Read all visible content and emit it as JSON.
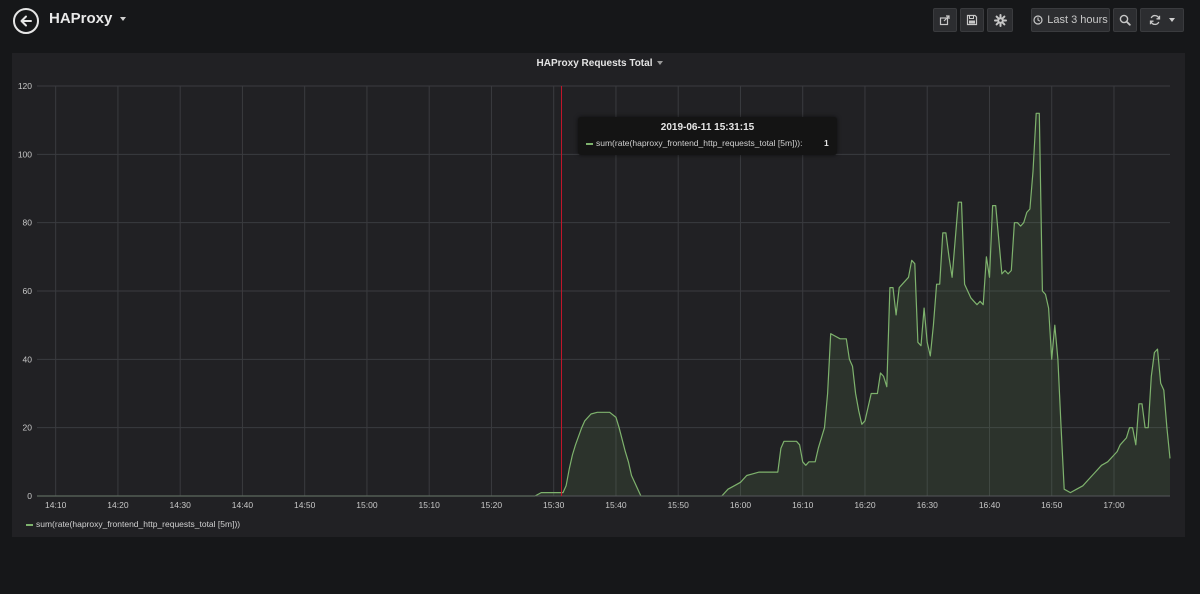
{
  "dashboard": {
    "title": "HAProxy",
    "time_range_label": "Last 3 hours"
  },
  "icons": {
    "back": "arrow-left-icon",
    "share": "share-icon",
    "save": "save-icon",
    "settings": "gear-icon",
    "clock": "clock-icon",
    "zoom": "zoom-out-icon",
    "refresh": "refresh-icon",
    "caret": "chevron-down-icon"
  },
  "panel": {
    "title": "HAProxy Requests Total"
  },
  "tooltip": {
    "time": "2019-06-11 15:31:15",
    "series": "sum(rate(haproxy_frontend_http_requests_total [5m])):",
    "value": "1"
  },
  "legend": {
    "label": "sum(rate(haproxy_frontend_http_requests_total [5m]))"
  },
  "colors": {
    "series": "#7eb26d",
    "crosshair": "#c4162a",
    "grid": "#3a3b3f"
  },
  "chart_data": {
    "type": "area",
    "ylim": [
      0,
      120
    ],
    "yticks": [
      0,
      20,
      40,
      60,
      80,
      100,
      120
    ],
    "xlim": [
      847,
      1029
    ],
    "xtick_values": [
      850,
      860,
      870,
      880,
      890,
      900,
      910,
      920,
      930,
      940,
      950,
      960,
      970,
      980,
      990,
      1000,
      1010,
      1020
    ],
    "xtick_labels": [
      "14:10",
      "14:20",
      "14:30",
      "14:40",
      "14:50",
      "15:00",
      "15:10",
      "15:20",
      "15:30",
      "15:40",
      "15:50",
      "16:00",
      "16:10",
      "16:20",
      "16:30",
      "16:40",
      "16:50",
      "17:00"
    ],
    "crosshair_x": 931.25,
    "grid": true,
    "legend": "bottom-left",
    "series": [
      {
        "name": "sum(rate(haproxy_frontend_http_requests_total [5m]))",
        "points": [
          [
            847,
            0
          ],
          [
            927,
            0
          ],
          [
            928,
            1
          ],
          [
            931.5,
            1
          ],
          [
            932,
            3
          ],
          [
            932.5,
            8
          ],
          [
            933,
            12
          ],
          [
            933.5,
            15
          ],
          [
            934.5,
            20
          ],
          [
            935,
            22
          ],
          [
            936,
            24
          ],
          [
            937,
            24.5
          ],
          [
            939,
            24.5
          ],
          [
            940,
            23
          ],
          [
            940.5,
            20
          ],
          [
            941.5,
            13
          ],
          [
            942,
            10
          ],
          [
            942.5,
            6
          ],
          [
            943,
            4
          ],
          [
            944,
            0
          ],
          [
            945,
            0
          ],
          [
            956,
            0
          ],
          [
            957,
            0
          ],
          [
            958,
            2
          ],
          [
            959,
            3
          ],
          [
            960,
            4
          ],
          [
            961,
            6
          ],
          [
            962,
            6.5
          ],
          [
            963,
            7
          ],
          [
            965,
            7
          ],
          [
            966,
            7
          ],
          [
            966.5,
            14
          ],
          [
            967,
            16
          ],
          [
            969,
            16
          ],
          [
            969.5,
            15
          ],
          [
            970,
            10
          ],
          [
            970.5,
            9
          ],
          [
            971,
            10
          ],
          [
            972,
            10
          ],
          [
            972.5,
            14
          ],
          [
            973,
            17
          ],
          [
            973.5,
            20
          ],
          [
            974,
            30
          ],
          [
            974.5,
            47.5
          ],
          [
            975,
            47
          ],
          [
            976,
            46
          ],
          [
            977,
            46
          ],
          [
            977.5,
            40
          ],
          [
            978,
            38
          ],
          [
            978.5,
            30
          ],
          [
            979,
            25
          ],
          [
            979.5,
            21
          ],
          [
            980,
            22
          ],
          [
            981,
            30
          ],
          [
            982,
            30
          ],
          [
            982.5,
            36
          ],
          [
            983,
            35
          ],
          [
            983.5,
            32
          ],
          [
            984,
            61
          ],
          [
            984.5,
            61
          ],
          [
            985,
            53
          ],
          [
            985.5,
            61
          ],
          [
            986,
            62
          ],
          [
            987,
            64
          ],
          [
            987.5,
            69
          ],
          [
            988,
            68
          ],
          [
            988.5,
            45
          ],
          [
            989,
            44
          ],
          [
            989.5,
            55
          ],
          [
            990,
            45
          ],
          [
            990.5,
            41
          ],
          [
            991,
            50
          ],
          [
            991.5,
            62
          ],
          [
            992,
            62
          ],
          [
            992.5,
            77
          ],
          [
            993,
            77
          ],
          [
            993.5,
            70
          ],
          [
            994,
            64
          ],
          [
            994.5,
            75
          ],
          [
            995,
            86
          ],
          [
            995.5,
            86
          ],
          [
            996,
            62
          ],
          [
            996.5,
            60
          ],
          [
            997,
            58
          ],
          [
            997.5,
            57
          ],
          [
            998,
            56
          ],
          [
            998.5,
            57
          ],
          [
            999,
            56
          ],
          [
            999.5,
            70
          ],
          [
            1000,
            64
          ],
          [
            1000.5,
            85
          ],
          [
            1001,
            85
          ],
          [
            1001.5,
            75
          ],
          [
            1002,
            65
          ],
          [
            1002.5,
            66
          ],
          [
            1003,
            65
          ],
          [
            1003.5,
            66
          ],
          [
            1004,
            80
          ],
          [
            1004.5,
            80
          ],
          [
            1005,
            79
          ],
          [
            1005.5,
            80
          ],
          [
            1006,
            83
          ],
          [
            1006.5,
            84
          ],
          [
            1007,
            95
          ],
          [
            1007.5,
            112
          ],
          [
            1008,
            112
          ],
          [
            1008.5,
            60
          ],
          [
            1009,
            59
          ],
          [
            1009.5,
            55
          ],
          [
            1010,
            40
          ],
          [
            1010.5,
            50
          ],
          [
            1011,
            40
          ],
          [
            1011.5,
            20
          ],
          [
            1012,
            2
          ],
          [
            1013,
            1
          ],
          [
            1014,
            2
          ],
          [
            1015,
            3
          ],
          [
            1016,
            5
          ],
          [
            1017,
            7
          ],
          [
            1018,
            9
          ],
          [
            1019,
            10
          ],
          [
            1020,
            12
          ],
          [
            1020.5,
            13
          ],
          [
            1021,
            15
          ],
          [
            1022,
            17
          ],
          [
            1022.5,
            20
          ],
          [
            1023,
            20
          ],
          [
            1023.5,
            15
          ],
          [
            1024,
            27
          ],
          [
            1024.5,
            27
          ],
          [
            1025,
            20
          ],
          [
            1025.5,
            20
          ],
          [
            1026,
            35
          ],
          [
            1026.5,
            42
          ],
          [
            1027,
            43
          ],
          [
            1027.5,
            33
          ],
          [
            1028,
            31
          ],
          [
            1028.5,
            20
          ],
          [
            1029,
            11
          ]
        ]
      }
    ]
  }
}
